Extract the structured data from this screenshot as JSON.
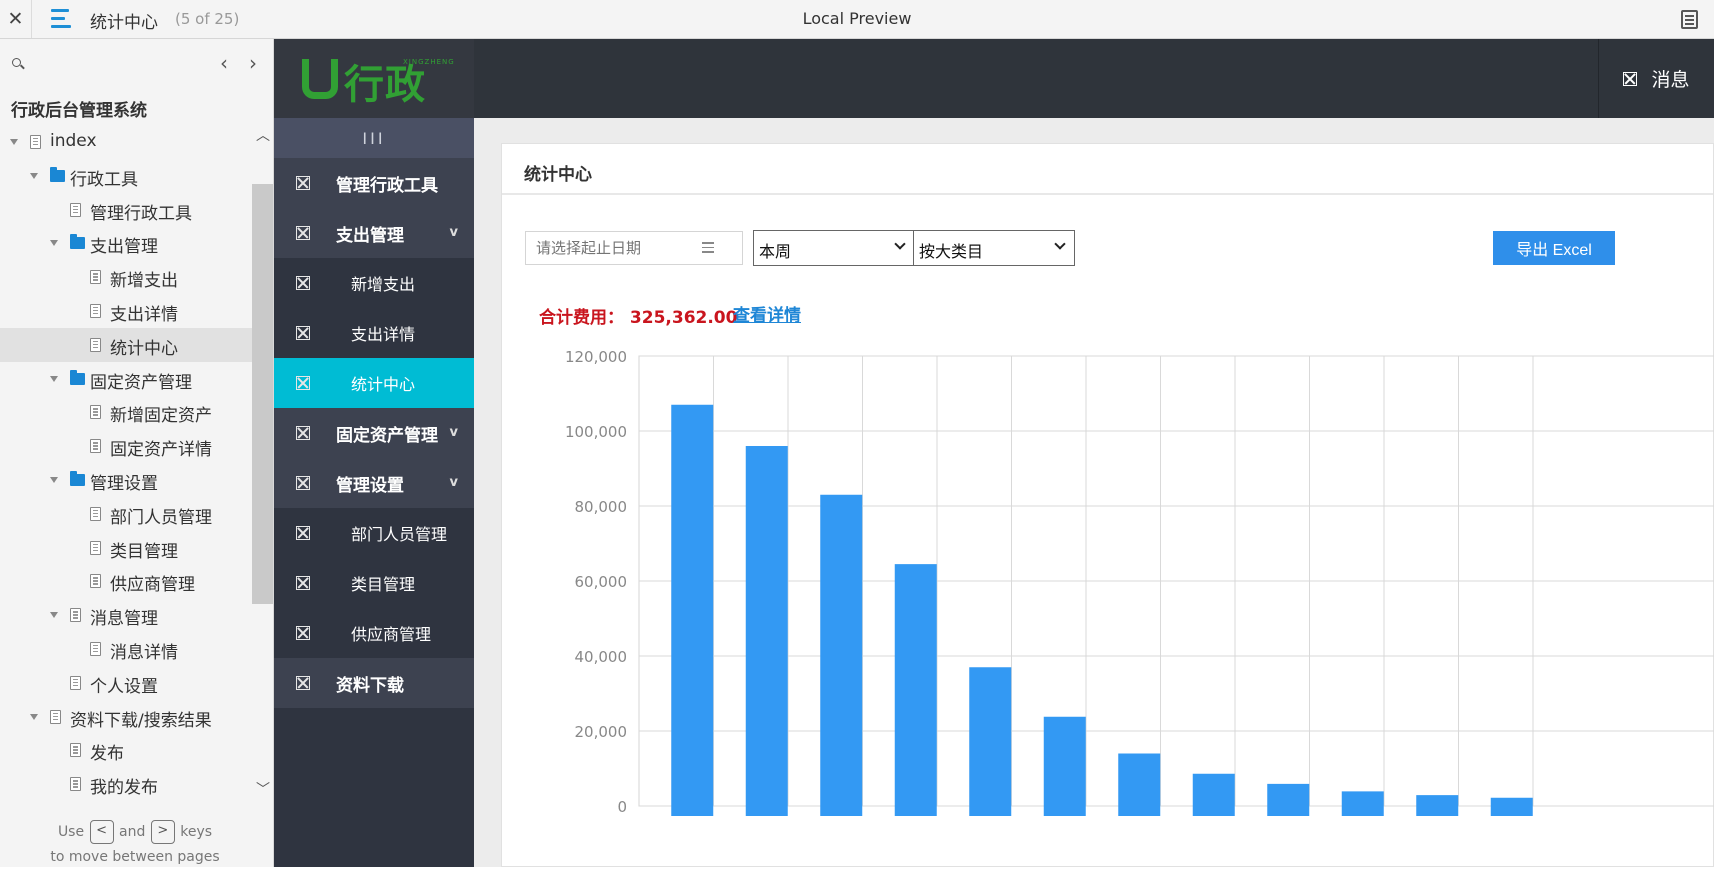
{
  "topbar": {
    "close": "✕",
    "title": "统计中心",
    "count": "(5 of 25)",
    "preview": "Local Preview"
  },
  "outline": {
    "heading": "行政后台管理系统",
    "items": [
      {
        "label": "index",
        "level": 0,
        "icon": "doc-icon",
        "expanded": true
      },
      {
        "label": "行政工具",
        "level": 1,
        "icon": "folder-icon",
        "expanded": true
      },
      {
        "label": "管理行政工具",
        "level": 2,
        "icon": "doc-icon"
      },
      {
        "label": "支出管理",
        "level": 2,
        "icon": "folder-icon",
        "expanded": true
      },
      {
        "label": "新增支出",
        "level": 3,
        "icon": "doc-icon"
      },
      {
        "label": "支出详情",
        "level": 3,
        "icon": "doc-icon"
      },
      {
        "label": "统计中心",
        "level": 3,
        "icon": "doc-icon",
        "active": true
      },
      {
        "label": "固定资产管理",
        "level": 2,
        "icon": "folder-icon",
        "expanded": true
      },
      {
        "label": "新增固定资产",
        "level": 3,
        "icon": "doc-icon"
      },
      {
        "label": "固定资产详情",
        "level": 3,
        "icon": "doc-icon"
      },
      {
        "label": "管理设置",
        "level": 2,
        "icon": "folder-icon",
        "expanded": true
      },
      {
        "label": "部门人员管理",
        "level": 3,
        "icon": "doc-icon"
      },
      {
        "label": "类目管理",
        "level": 3,
        "icon": "doc-icon"
      },
      {
        "label": "供应商管理",
        "level": 3,
        "icon": "doc-icon"
      },
      {
        "label": "消息管理",
        "level": 2,
        "icon": "doc-icon",
        "expanded": true
      },
      {
        "label": "消息详情",
        "level": 3,
        "icon": "doc-icon"
      },
      {
        "label": "个人设置",
        "level": 2,
        "icon": "doc-icon"
      },
      {
        "label": "资料下载/搜索结果",
        "level": 1,
        "icon": "doc-icon",
        "expanded": true
      },
      {
        "label": "发布",
        "level": 2,
        "icon": "doc-icon"
      },
      {
        "label": "我的发布",
        "level": 2,
        "icon": "doc-icon"
      }
    ],
    "hint": {
      "use": "Use",
      "and": "and",
      "keys": "keys",
      "line2": "to move between pages",
      "key_left": "<",
      "key_right": ">"
    }
  },
  "app": {
    "logo": {
      "text": "行政",
      "small": "XINGZHENG"
    },
    "header_message": "消息",
    "nav_toggle": "III",
    "nav": [
      {
        "label": "管理行政工具",
        "type": "top"
      },
      {
        "label": "支出管理",
        "type": "top",
        "chevron": "v"
      },
      {
        "label": "新增支出",
        "type": "sub"
      },
      {
        "label": "支出详情",
        "type": "sub"
      },
      {
        "label": "统计中心",
        "type": "sub",
        "active": true
      },
      {
        "label": "固定资产管理",
        "type": "top",
        "chevron": "v"
      },
      {
        "label": "管理设置",
        "type": "top",
        "chevron": "v"
      },
      {
        "label": "部门人员管理",
        "type": "sub"
      },
      {
        "label": "类目管理",
        "type": "sub"
      },
      {
        "label": "供应商管理",
        "type": "sub"
      },
      {
        "label": "资料下载",
        "type": "top"
      }
    ],
    "panel": {
      "title": "统计中心",
      "date_placeholder": "请选择起止日期",
      "period_select": "本周",
      "category_select": "按大类目",
      "export_label": "导出 Excel",
      "total_label": "合计费用：",
      "total_value": "325,362.00",
      "detail_link": "查看详情"
    }
  },
  "chart_data": {
    "type": "bar",
    "color": "#3399f3",
    "ylim": [
      0,
      120000
    ],
    "yticks": [
      "0",
      "20,000",
      "40,000",
      "60,000",
      "80,000",
      "100,000",
      "120,000"
    ],
    "values": [
      107000,
      96000,
      83000,
      64500,
      37000,
      23800,
      14000,
      8600,
      5900,
      3900,
      2900,
      2200
    ]
  }
}
